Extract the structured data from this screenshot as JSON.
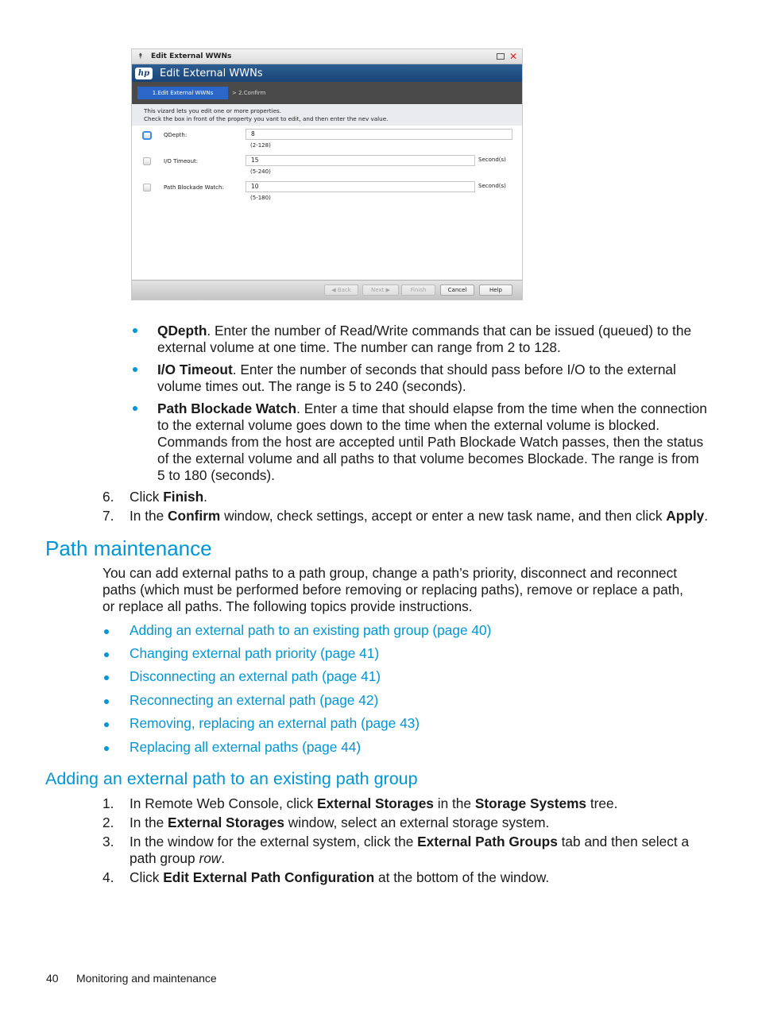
{
  "dialog": {
    "window_title": "Edit External WWNs",
    "banner_title": "Edit External WWNs",
    "logo_text": "hp",
    "steps": {
      "active": "1.Edit External WWNs",
      "next": "> 2.Confirm"
    },
    "info_lines": [
      "This vizard lets you edit one or more properties.",
      "Check the box in front of the property you vant to edit, and then enter the nev value."
    ],
    "fields": [
      {
        "label": "QDepth:",
        "value": "8",
        "range": "(2-128)",
        "unit": "",
        "checked": false
      },
      {
        "label": "I/O Timeout:",
        "value": "15",
        "range": "(5-240)",
        "unit": "Second(s)",
        "checked": false
      },
      {
        "label": "Path Blockade Watch:",
        "value": "10",
        "range": "(5-180)",
        "unit": "Second(s)",
        "checked": false
      }
    ],
    "buttons": {
      "back": "◀ Back",
      "next": "Next ▶",
      "finish": "Finish",
      "cancel": "Cancel",
      "help": "Help"
    }
  },
  "param_bullets": [
    {
      "term": "QDepth",
      "lines": [
        ". Enter the number of Read/Write commands that can be issued (queued) to the",
        "external volume at one time. The number can range from 2 to 128."
      ]
    },
    {
      "term": "I/O Timeout",
      "lines": [
        ". Enter the number of seconds that should pass before I/O to the external",
        "volume times out. The range is 5 to 240 (seconds)."
      ]
    },
    {
      "term": "Path Blockade Watch",
      "lines": [
        ". Enter a time that should elapse from the time when the connection",
        "to the external volume goes down to the time when the external volume is blocked.",
        "Commands from the host are accepted until Path Blockade Watch passes, then the status",
        "of the external volume and all paths to that volume becomes Blockade. The range is from",
        "5 to 180 (seconds)."
      ]
    }
  ],
  "steps_a": [
    {
      "num": "6.",
      "pre": "Click ",
      "bold": "Finish",
      "post": "."
    },
    {
      "num": "7.",
      "pre": "In the ",
      "bold": "Confirm",
      "mid": " window, check settings, accept or enter a new task name, and then click ",
      "bold2": "Apply",
      "post": "."
    }
  ],
  "section_path_maintenance": {
    "heading": "Path maintenance",
    "intro": [
      "You can add external paths to a path group, change a path’s priority, disconnect and reconnect",
      "paths (which must be performed before removing or replacing paths), remove or replace a path,",
      "or replace all paths. The following topics provide instructions."
    ],
    "links": [
      "Adding an external path to an existing path group (page 40)",
      "Changing external path priority (page 41)",
      "Disconnecting an external path (page 41)",
      "Reconnecting an external path (page 42)",
      "Removing, replacing an external path (page 43)",
      "Replacing all external paths (page 44)"
    ]
  },
  "section_adding": {
    "heading": "Adding an external path to an existing path group",
    "steps": [
      {
        "num": "1.",
        "pre": "In Remote Web Console, click ",
        "b1": "External Storages",
        "mid": " in the ",
        "b2": "Storage Systems",
        "post": " tree."
      },
      {
        "num": "2.",
        "pre": "In the ",
        "b1": "External Storages",
        "post": " window, select an external storage system."
      },
      {
        "num": "3.",
        "pre": "In the window for the external system, click the ",
        "b1": "External Path Groups",
        "post": " tab and then select a",
        "line2": "path group ",
        "italic": "row",
        "post2": "."
      },
      {
        "num": "4.",
        "pre": "Click ",
        "b1": "Edit External Path Configuration",
        "post": " at the bottom of the window."
      }
    ]
  },
  "page_footer": {
    "page_number": "40",
    "section": "Monitoring and maintenance"
  },
  "colors": {
    "accent": "#0096d6",
    "dialog_banner": "#1a4375",
    "step_active": "#2b66c9"
  }
}
